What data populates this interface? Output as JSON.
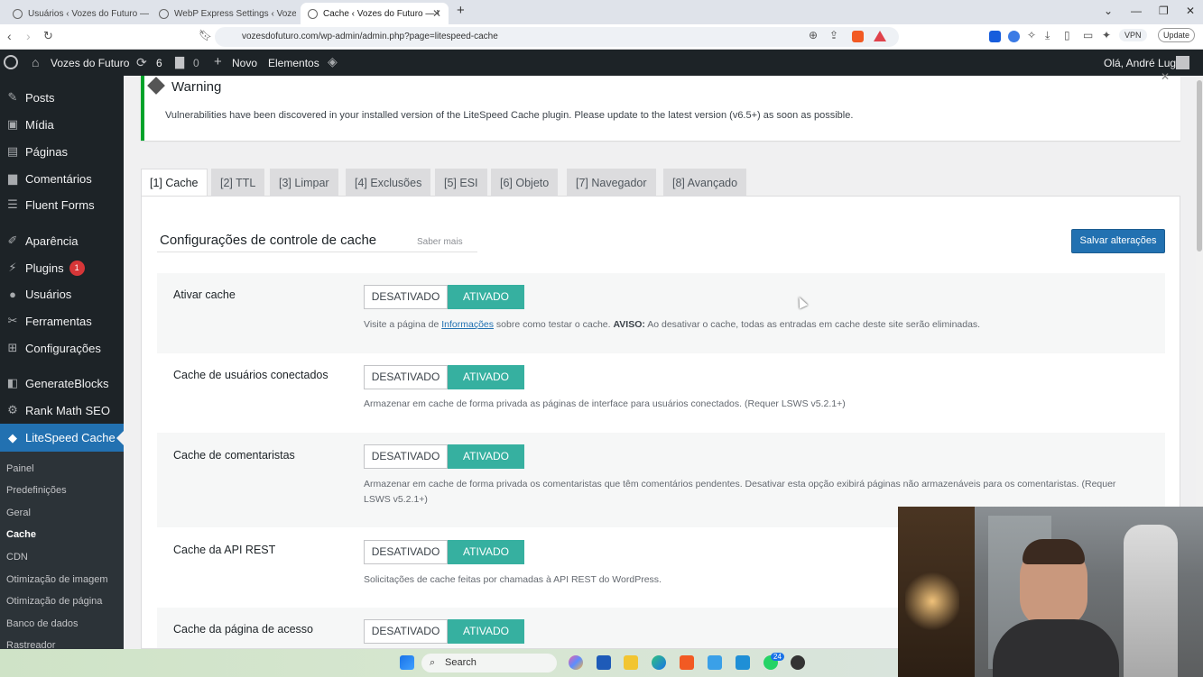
{
  "browser": {
    "tabs": [
      {
        "label": "Usuários ‹ Vozes do Futuro — Word"
      },
      {
        "label": "WebP Express Settings ‹ Vozes do F"
      },
      {
        "label": "Cache ‹ Vozes do Futuro — Wo"
      }
    ],
    "new_tab": "+",
    "url": "vozesdofuturo.com/wp-admin/admin.php?page=litespeed-cache",
    "vpn": "VPN",
    "update": "Update"
  },
  "adminbar": {
    "site_name": "Vozes do Futuro",
    "updates_count": "6",
    "comments_count": "0",
    "new": "Novo",
    "elements": "Elementos",
    "greeting": "Olá, André Lug"
  },
  "sidebar": {
    "items": [
      {
        "label": "Posts",
        "icon": "pin-icon"
      },
      {
        "label": "Mídia",
        "icon": "media-icon"
      },
      {
        "label": "Páginas",
        "icon": "page-icon"
      },
      {
        "label": "Comentários",
        "icon": "comment-icon"
      },
      {
        "label": "Fluent Forms",
        "icon": "form-icon"
      },
      {
        "label": "Aparência",
        "icon": "brush-icon"
      },
      {
        "label": "Plugins",
        "icon": "plugin-icon",
        "badge": "1"
      },
      {
        "label": "Usuários",
        "icon": "user-icon"
      },
      {
        "label": "Ferramentas",
        "icon": "wrench-icon"
      },
      {
        "label": "Configurações",
        "icon": "settings-icon"
      },
      {
        "label": "GenerateBlocks",
        "icon": "blocks-icon"
      },
      {
        "label": "Rank Math SEO",
        "icon": "chart-icon"
      },
      {
        "label": "LiteSpeed Cache",
        "icon": "litespeed-icon"
      }
    ],
    "submenu": [
      "Painel",
      "Predefinições",
      "Geral",
      "Cache",
      "CDN",
      "Otimização de imagem",
      "Otimização de página",
      "Banco de dados",
      "Rastreador"
    ]
  },
  "warning": {
    "title": "Warning",
    "message": "Vulnerabilities have been discovered in your installed version of the LiteSpeed Cache plugin. Please update to the latest version (v6.5+) as soon as possible."
  },
  "tabs": [
    "[1] Cache",
    "[2] TTL",
    "[3] Limpar",
    "[4] Exclusões",
    "[5] ESI",
    "[6] Objeto",
    "[7] Navegador",
    "[8] Avançado"
  ],
  "panel": {
    "title": "Configurações de controle de cache",
    "learn_more": "Saber mais",
    "save": "Salvar alterações",
    "off_label": "DESATIVADO",
    "on_label": "ATIVADO",
    "rows": [
      {
        "label": "Ativar cache",
        "desc_pre": "Visite a página de ",
        "desc_link": "Informações",
        "desc_mid": " sobre como testar o cache. ",
        "desc_bold": "AVISO:",
        "desc_post": " Ao desativar o cache, todas as entradas em cache deste site serão eliminadas."
      },
      {
        "label": "Cache de usuários conectados",
        "desc": "Armazenar em cache de forma privada as páginas de interface para usuários conectados. (Requer LSWS v5.2.1+)"
      },
      {
        "label": "Cache de comentaristas",
        "desc": "Armazenar em cache de forma privada os comentaristas que têm comentários pendentes. Desativar esta opção exibirá páginas não armazenáveis para os comentaristas. (Requer LSWS v5.2.1+)"
      },
      {
        "label": "Cache da API REST",
        "desc": "Solicitações de cache feitas por chamadas à API REST do WordPress."
      },
      {
        "label": "Cache da página de acesso",
        "desc": ""
      }
    ]
  },
  "taskbar": {
    "search": "Search",
    "whatsapp_badge": "24"
  },
  "colors": {
    "accent": "#2271b1",
    "toggle_on": "#36b0a0",
    "admin_dark": "#1d2327",
    "warning_border": "#00a32a"
  }
}
